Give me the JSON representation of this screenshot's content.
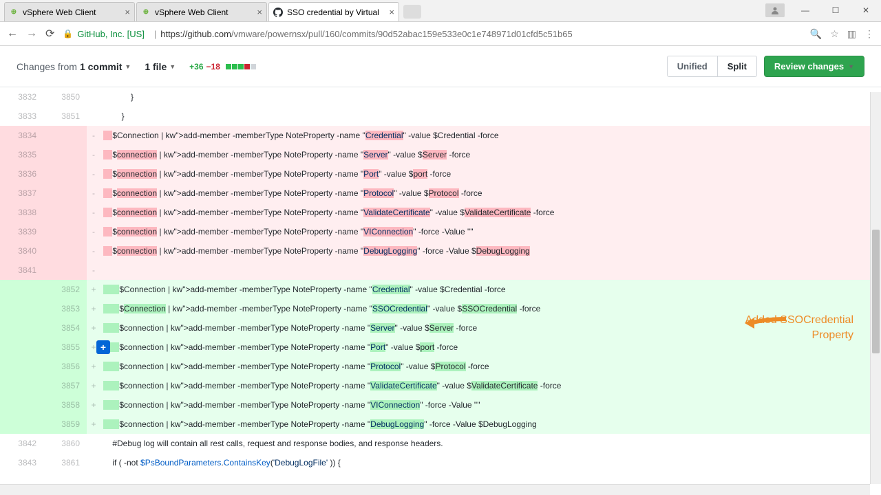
{
  "browser": {
    "tabs": [
      {
        "title": "vSphere Web Client",
        "active": false,
        "favicon": "v"
      },
      {
        "title": "vSphere Web Client",
        "active": false,
        "favicon": "v"
      },
      {
        "title": "SSO credential by Virtual",
        "active": true,
        "favicon": "gh"
      }
    ],
    "url_org": "GitHub, Inc. [US]",
    "url_host": "https://github.com",
    "url_path": "/vmware/powernsx/pull/160/commits/90d52abac159e533e0c1e748971d01cfd5c51b65"
  },
  "pr_header": {
    "changes_from": "Changes from",
    "commit_count": "1 commit",
    "file_count": "1 file",
    "additions": "+36",
    "deletions": "−18",
    "unified": "Unified",
    "split": "Split",
    "review": "Review changes"
  },
  "diff": {
    "ctx": [
      {
        "l": "3832",
        "r": "3850",
        "code": "            }"
      },
      {
        "l": "3833",
        "r": "3851",
        "code": "        }"
      }
    ],
    "del": [
      {
        "l": "3834",
        "code": "    $Connection | add-member -memberType NoteProperty -name \"Credential\" -value $Credential -force"
      },
      {
        "l": "3835",
        "code": "    $connection | add-member -memberType NoteProperty -name \"Server\" -value $Server -force"
      },
      {
        "l": "3836",
        "code": "    $connection | add-member -memberType NoteProperty -name \"Port\" -value $port -force"
      },
      {
        "l": "3837",
        "code": "    $connection | add-member -memberType NoteProperty -name \"Protocol\" -value $Protocol -force"
      },
      {
        "l": "3838",
        "code": "    $connection | add-member -memberType NoteProperty -name \"ValidateCertificate\" -value $ValidateCertificate -force"
      },
      {
        "l": "3839",
        "code": "    $connection | add-member -memberType NoteProperty -name \"VIConnection\" -force -Value \"\""
      },
      {
        "l": "3840",
        "code": "    $connection | add-member -memberType NoteProperty -name \"DebugLogging\" -force -Value $DebugLogging"
      },
      {
        "l": "3841",
        "code": ""
      }
    ],
    "add": [
      {
        "r": "3852",
        "code": "       $Connection | add-member -memberType NoteProperty -name \"Credential\" -value $Credential -force"
      },
      {
        "r": "3853",
        "code": "       $Connection | add-member -memberType NoteProperty -name \"SSOCredential\" -value $SSOCredential -force",
        "sso": true
      },
      {
        "r": "3854",
        "code": "       $connection | add-member -memberType NoteProperty -name \"Server\" -value $Server -force"
      },
      {
        "r": "3855",
        "code": "       $connection | add-member -memberType NoteProperty -name \"Port\" -value $port -force",
        "add_btn": true
      },
      {
        "r": "3856",
        "code": "       $connection | add-member -memberType NoteProperty -name \"Protocol\" -value $Protocol -force"
      },
      {
        "r": "3857",
        "code": "       $connection | add-member -memberType NoteProperty -name \"ValidateCertificate\" -value $ValidateCertificate -force"
      },
      {
        "r": "3858",
        "code": "       $connection | add-member -memberType NoteProperty -name \"VIConnection\" -force -Value \"\""
      },
      {
        "r": "3859",
        "code": "       $connection | add-member -memberType NoteProperty -name \"DebugLogging\" -force -Value $DebugLogging"
      }
    ],
    "ctx2": [
      {
        "l": "3842",
        "r": "3860",
        "code": "    #Debug log will contain all rest calls, request and response bodies, and response headers."
      },
      {
        "l": "3843",
        "r": "3861",
        "code": "    if ( -not $PsBoundParameters.ContainsKey('DebugLogFile' )) {"
      }
    ]
  },
  "annotation": {
    "line1": "Added SSOCredential",
    "line2": "Property"
  }
}
